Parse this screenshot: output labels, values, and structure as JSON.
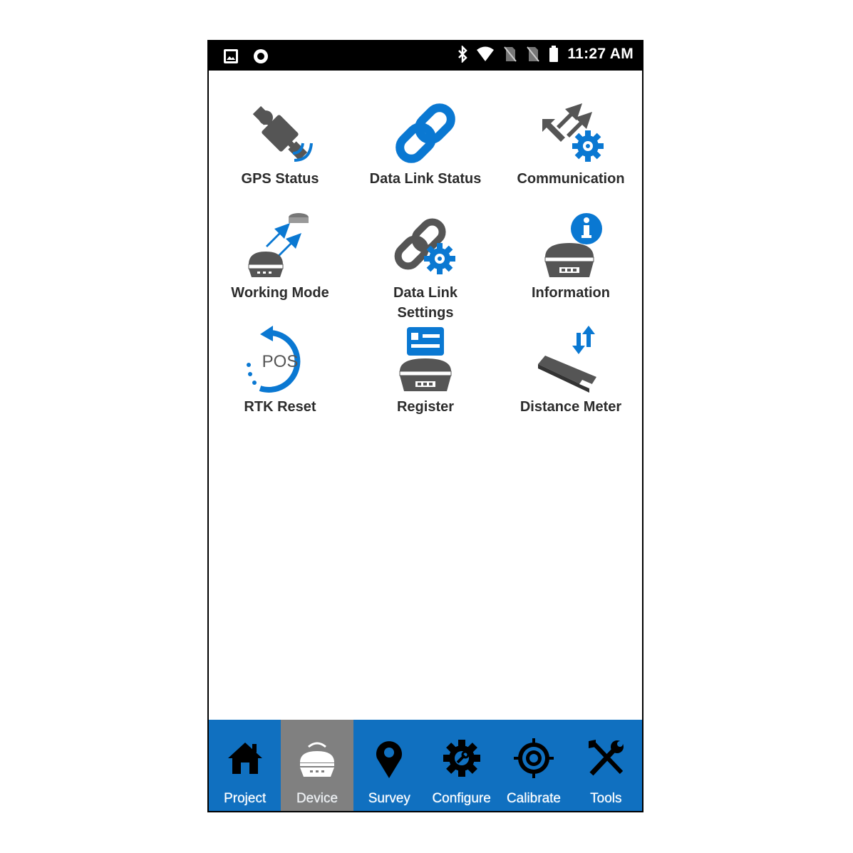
{
  "status_bar": {
    "time": "11:27 AM"
  },
  "tiles": [
    {
      "label": "GPS Status",
      "icon": "satellite-icon"
    },
    {
      "label": "Data Link Status",
      "icon": "link-icon"
    },
    {
      "label": "Communication",
      "icon": "communication-settings-icon"
    },
    {
      "label": "Working Mode",
      "icon": "working-mode-icon"
    },
    {
      "label": "Data Link Settings",
      "icon": "link-settings-icon"
    },
    {
      "label": "Information",
      "icon": "info-icon"
    },
    {
      "label": "RTK Reset",
      "icon": "pos-reset-icon"
    },
    {
      "label": "Register",
      "icon": "register-icon"
    },
    {
      "label": "Distance Meter",
      "icon": "distance-meter-icon"
    }
  ],
  "nav": [
    {
      "label": "Project",
      "icon": "home-icon"
    },
    {
      "label": "Device",
      "icon": "receiver-icon",
      "active": true
    },
    {
      "label": "Survey",
      "icon": "map-pin-icon"
    },
    {
      "label": "Configure",
      "icon": "gear-icon"
    },
    {
      "label": "Calibrate",
      "icon": "target-icon"
    },
    {
      "label": "Tools",
      "icon": "tools-icon"
    }
  ],
  "colors": {
    "accent": "#1070c0",
    "icon_blue": "#0a78d2",
    "icon_gray": "#555555",
    "active_tab": "#808080"
  }
}
